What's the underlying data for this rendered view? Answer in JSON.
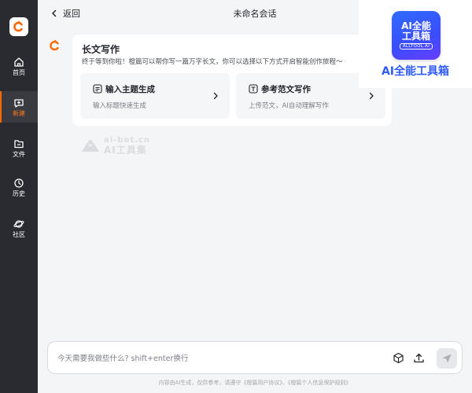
{
  "sidebar": {
    "items": [
      {
        "label": "首页",
        "icon": "home-icon"
      },
      {
        "label": "新建",
        "icon": "new-chat-icon"
      },
      {
        "label": "文件",
        "icon": "folder-icon"
      },
      {
        "label": "历史",
        "icon": "history-icon"
      },
      {
        "label": "社区",
        "icon": "planet-icon"
      }
    ],
    "active_index": 1
  },
  "header": {
    "back_label": "返回",
    "title": "未命名会话"
  },
  "message": {
    "title": "长文写作",
    "description": "终于等到你啦！橙篇可以帮你写一篇万字长文，你可以选择以下方式开启智能创作旅程～",
    "options": [
      {
        "title": "输入主题生成",
        "desc": "输入标题快速生成",
        "icon": "list-doc-icon"
      },
      {
        "title": "参考范文写作",
        "desc": "上传范文，AI自动理解写作",
        "icon": "template-t-icon"
      }
    ]
  },
  "watermark": {
    "line1": "ai-bot.cn",
    "line2": "AI工具集"
  },
  "promo": {
    "box_line1": "AI全能",
    "box_line2": "工具箱",
    "box_tag": "ALLTOOL.AI",
    "caption": "AI全能工具箱"
  },
  "composer": {
    "placeholder": "今天需要我做些什么? shift+enter换行"
  },
  "footer": {
    "disclaimer": "内容由AI生成，仅供参考，请遵守《橙篇用户协议》、《橙篇个人信息保护规则》"
  },
  "colors": {
    "sidebar_bg": "#2a2b30",
    "accent": "#ff6a00",
    "brand_blue": "#2f5bff"
  }
}
